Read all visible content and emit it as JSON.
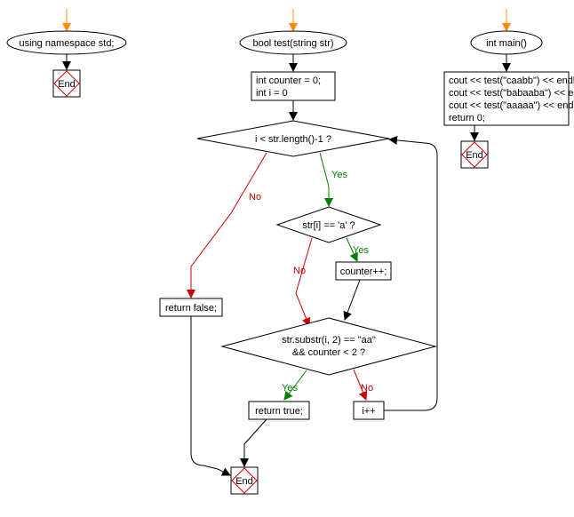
{
  "flow1": {
    "n1": "using namespace std;",
    "end": "End"
  },
  "flow2": {
    "n1": "bool test(string str)",
    "n2_l1": "int counter = 0;",
    "n2_l2": "int i = 0",
    "cond1": "i < str.length()-1 ?",
    "cond2": "str[i] == 'a' ?",
    "n3": "counter++;",
    "cond3_l1": "str.substr(i, 2) == \"aa\"",
    "cond3_l2": "&& counter < 2 ?",
    "n4": "return false;",
    "n5": "return true;",
    "n6": "i++",
    "end": "End"
  },
  "flow3": {
    "n1": "int main()",
    "n2_l1": "cout << test(\"caabb\") << endl;",
    "n2_l2": "cout << test(\"babaaba\") << endl;",
    "n2_l3": "cout << test(\"aaaaa\") << endl;",
    "n2_l4": "return 0;",
    "end": "End"
  },
  "labels": {
    "yes": "Yes",
    "no": "No"
  }
}
